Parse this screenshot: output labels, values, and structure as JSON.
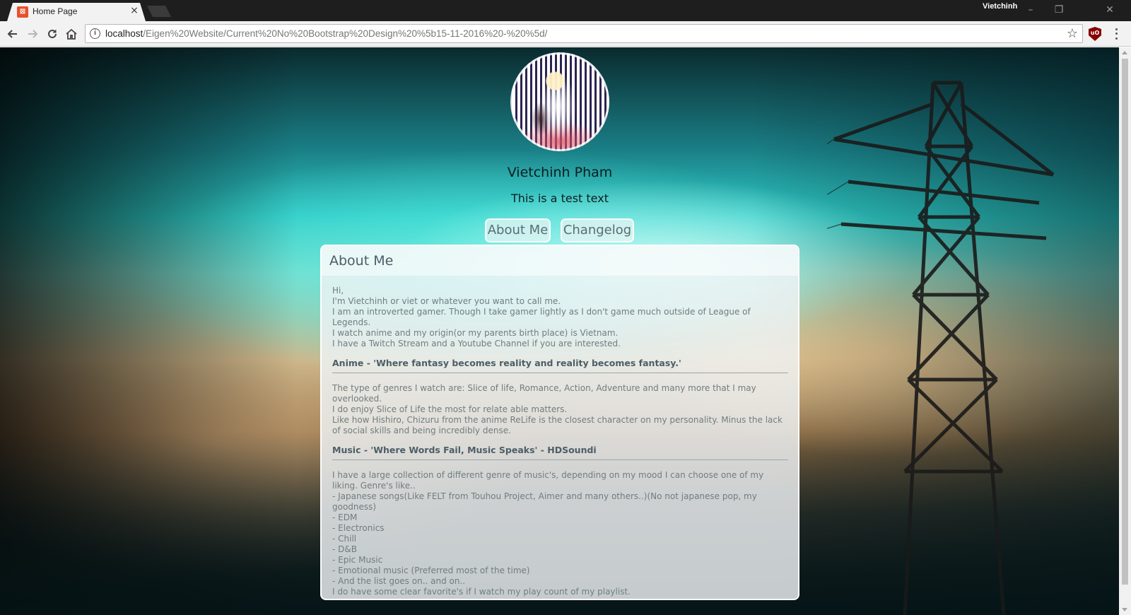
{
  "browser": {
    "tab_title": "Home Page",
    "tab_favicon": "xampp-favicon-icon",
    "profile_name": "Vietchinh",
    "url_host": "localhost",
    "url_path": "/Eigen%20Website/Current%20No%20Bootstrap%20Design%20%5b15-11-2016%20-%20%5d/",
    "tab_close": "×",
    "omni_info": "i",
    "bookmark_star": "☆",
    "extension_label": "uO",
    "window_controls": {
      "minimize": "–",
      "restore": "❐",
      "close": "✕"
    },
    "nav_icons": [
      "back-arrow-icon",
      "forward-arrow-icon",
      "reload-icon",
      "home-icon"
    ]
  },
  "profile": {
    "name": "Vietchinh Pham",
    "tagline": "This is a test text"
  },
  "nav": {
    "about_label": "About Me",
    "changelog_label": "Changelog"
  },
  "about": {
    "title": "About Me",
    "intro": [
      "Hi,",
      "I'm Vietchinh or viet or whatever you want to call me.",
      "I am an introverted gamer. Though I take gamer lightly as I don't game much outside of League of Legends.",
      "I watch anime and my origin(or my parents birth place) is Vietnam.",
      "I have a Twitch Stream and a Youtube Channel if you are interested."
    ],
    "anime_heading": "Anime - 'Where fantasy becomes reality and reality becomes fantasy.'",
    "anime_lines": [
      "The type of genres I watch are: Slice of life, Romance, Action, Adventure and many more that I may overlooked.",
      "I do enjoy Slice of Life the most for relate able matters.",
      "Like how Hishiro, Chizuru from the anime ReLife is the closest character on my personality. Minus the lack of social skills and being incredibly dense."
    ],
    "music_heading": "Music - 'Where Words Fail, Music Speaks' - HDSoundi",
    "music_lines": [
      "I have a large collection of different genre of music's, depending on my mood I can choose one of my liking. Genre's like..",
      "- Japanese songs(Like FELT from Touhou Project, Aimer and many others..)(No not japanese pop, my goodness)",
      "- EDM",
      "- Electronics",
      "- Chill",
      "- D&B",
      "- Epic Music",
      "- Emotional music (Preferred most of the time)",
      "- And the list goes on.. and on..",
      "I do have some clear favorite's if I watch my play count of my playlist."
    ]
  }
}
